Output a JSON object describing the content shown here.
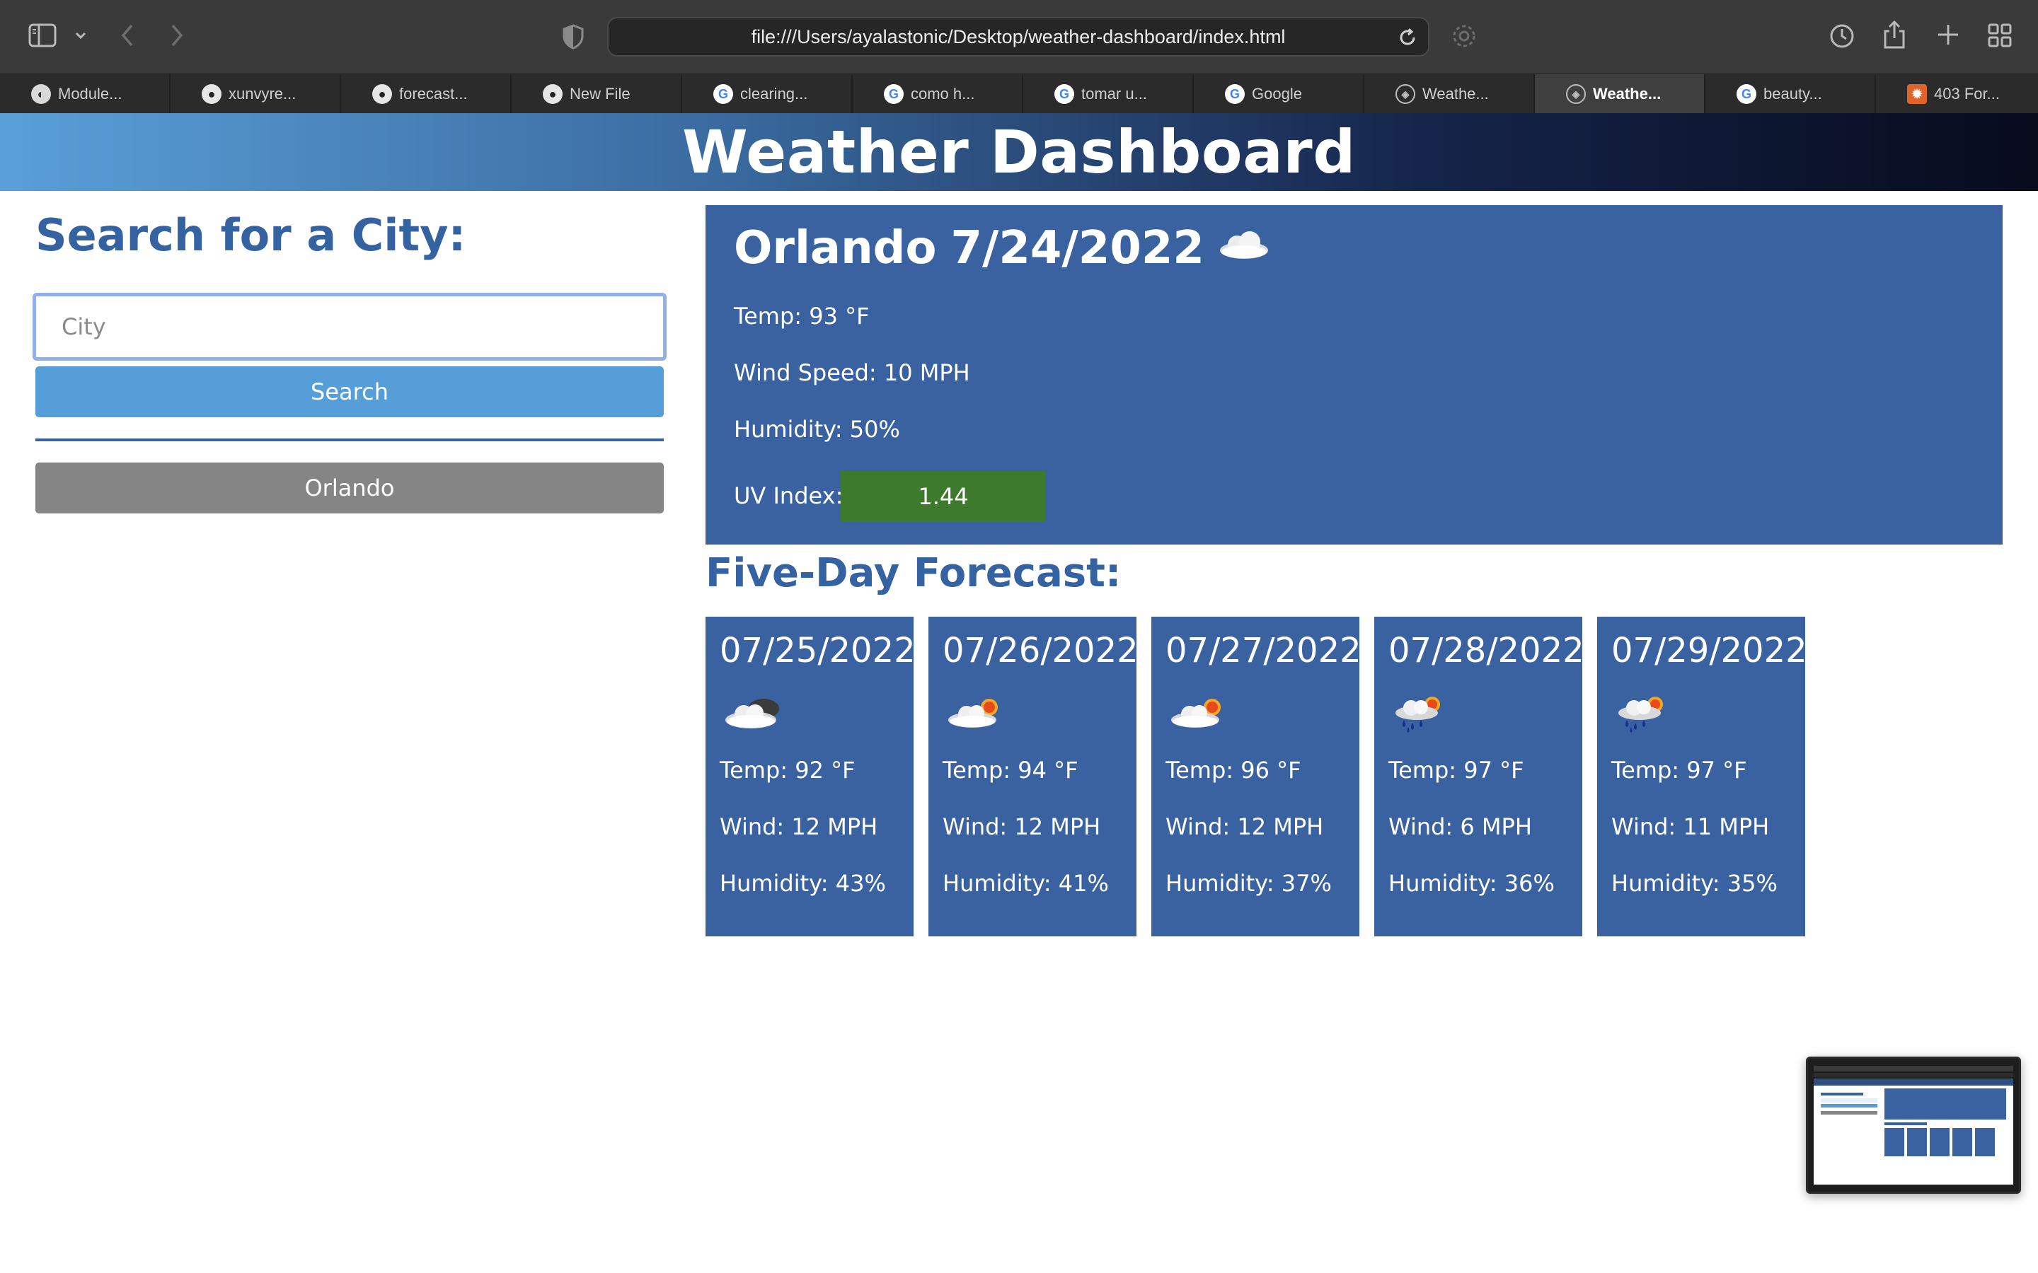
{
  "browser": {
    "url": "file:///Users/ayalastonic/Desktop/weather-dashboard/index.html",
    "tabs": [
      {
        "label": "Module...",
        "icon": "module-icon"
      },
      {
        "label": "xunvyre...",
        "icon": "github-icon"
      },
      {
        "label": "forecast...",
        "icon": "github-icon"
      },
      {
        "label": "New File",
        "icon": "github-icon"
      },
      {
        "label": "clearing...",
        "icon": "google-icon"
      },
      {
        "label": "como h...",
        "icon": "google-icon"
      },
      {
        "label": "tomar u...",
        "icon": "google-icon"
      },
      {
        "label": "Google",
        "icon": "google-icon"
      },
      {
        "label": "Weathe...",
        "icon": "compass-icon"
      },
      {
        "label": "Weathe...",
        "icon": "compass-icon",
        "active": true
      },
      {
        "label": "beauty...",
        "icon": "google-icon"
      },
      {
        "label": "403 For...",
        "icon": "sun-square-icon"
      }
    ]
  },
  "header": {
    "title": "Weather Dashboard"
  },
  "search": {
    "title": "Search for a City:",
    "placeholder": "City",
    "value": "",
    "button_label": "Search",
    "history": [
      "Orlando"
    ]
  },
  "current": {
    "city": "Orlando",
    "date": "7/24/2022",
    "icon": "cloud-icon",
    "temp": "Temp: 93 °F",
    "wind": "Wind Speed: 10 MPH",
    "humidity": "Humidity: 50%",
    "uv_label": "UV Index:",
    "uv_value": "1.44",
    "uv_color": "#3d7a2c"
  },
  "forecast": {
    "title": "Five-Day Forecast:",
    "days": [
      {
        "date": "07/25/2022",
        "icon": "cloudy-icon",
        "temp": "Temp: 92 °F",
        "wind": "Wind: 12 MPH",
        "humidity": "Humidity: 43%"
      },
      {
        "date": "07/26/2022",
        "icon": "partly-sunny-icon",
        "temp": "Temp: 94 °F",
        "wind": "Wind: 12 MPH",
        "humidity": "Humidity: 41%"
      },
      {
        "date": "07/27/2022",
        "icon": "partly-sunny-icon",
        "temp": "Temp: 96 °F",
        "wind": "Wind: 12 MPH",
        "humidity": "Humidity: 37%"
      },
      {
        "date": "07/28/2022",
        "icon": "sun-rain-icon",
        "temp": "Temp: 97 °F",
        "wind": "Wind: 6 MPH",
        "humidity": "Humidity: 36%"
      },
      {
        "date": "07/29/2022",
        "icon": "sun-rain-icon",
        "temp": "Temp: 97 °F",
        "wind": "Wind: 11 MPH",
        "humidity": "Humidity: 35%"
      }
    ]
  },
  "colors": {
    "brand_blue": "#3562a0",
    "card_blue": "#3a62a0",
    "button_blue": "#559ed8",
    "history_gray": "#858585"
  }
}
